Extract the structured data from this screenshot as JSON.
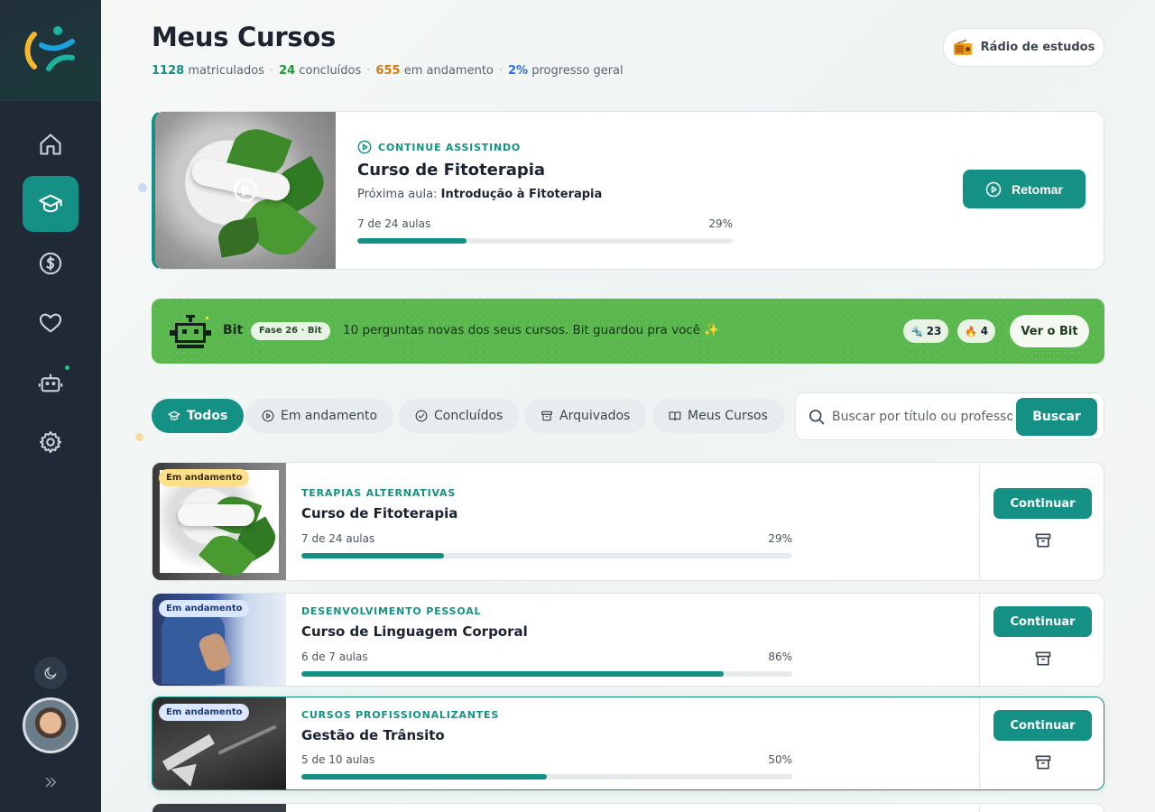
{
  "sidebar": {
    "items": [
      {
        "name": "home",
        "icon": "home-icon",
        "active": false
      },
      {
        "name": "courses",
        "icon": "graduation-cap-icon",
        "active": true
      },
      {
        "name": "finance",
        "icon": "dollar-circle-icon",
        "active": false
      },
      {
        "name": "favorites",
        "icon": "heart-icon",
        "active": false
      },
      {
        "name": "bot",
        "icon": "robot-icon",
        "active": false
      },
      {
        "name": "settings",
        "icon": "gear-icon",
        "active": false
      }
    ],
    "theme_icon": "moon-icon",
    "expand_icon": "chevrons-right-icon"
  },
  "header": {
    "title": "Meus Cursos",
    "stats": {
      "enrolled_value": "1128",
      "enrolled_label": "matriculados",
      "completed_value": "24",
      "completed_label": "concluídos",
      "in_progress_value": "655",
      "in_progress_label": "em andamento",
      "progress_value": "2%",
      "progress_label": "progresso geral"
    },
    "radio_label": "Rádio de estudos"
  },
  "continue": {
    "label": "CONTINUE ASSISTINDO",
    "title": "Curso de Fitoterapia",
    "next_prefix": "Próxima aula:",
    "next_lesson": "Introdução à Fitoterapia",
    "lessons_text": "7 de 24 aulas",
    "percent_text": "29%",
    "progress": 0.29,
    "resume_label": "Retomar"
  },
  "bit": {
    "name": "Bit",
    "phase": "Fase 26 · Bit",
    "message": "10 perguntas novas dos seus cursos. Bit guardou pra você ✨",
    "bolts_count": "23",
    "streak_count": "4",
    "cta_label": "Ver o Bit"
  },
  "filters": [
    {
      "label": "Todos",
      "active": true,
      "icon": "graduation-cap-icon"
    },
    {
      "label": "Em andamento",
      "active": false,
      "icon": "play-circle-icon"
    },
    {
      "label": "Concluídos",
      "active": false,
      "icon": "check-circle-icon"
    },
    {
      "label": "Arquivados",
      "active": false,
      "icon": "archive-icon"
    },
    {
      "label": "Meus Cursos",
      "active": false,
      "icon": "book-open-icon"
    }
  ],
  "search": {
    "placeholder": "Buscar por título ou professor",
    "button_label": "Buscar"
  },
  "courses": [
    {
      "badge": "Em andamento",
      "badge_style": "yellow",
      "category": "TERAPIAS ALTERNATIVAS",
      "title": "Curso de Fitoterapia",
      "lessons_text": "7 de 24 aulas",
      "percent_text": "29%",
      "progress": 0.29,
      "button_label": "Continuar"
    },
    {
      "badge": "Em andamento",
      "badge_style": "blue",
      "category": "DESENVOLVIMENTO PESSOAL",
      "title": "Curso de Linguagem Corporal",
      "lessons_text": "6 de 7 aulas",
      "percent_text": "86%",
      "progress": 0.86,
      "button_label": "Continuar"
    },
    {
      "badge": "Em andamento",
      "badge_style": "blue",
      "category": "CURSOS PROFISSIONALIZANTES",
      "title": "Gestão de Trânsito",
      "lessons_text": "5 de 10 aulas",
      "percent_text": "50%",
      "progress": 0.5,
      "button_label": "Continuar"
    }
  ],
  "colors": {
    "accent": "#149184",
    "sidebar": "#1f2a36",
    "bit_green": "#5bb84e",
    "enrolled": "#149184",
    "completed": "#1f9a3a",
    "in_progress": "#d07a12",
    "overall": "#2f6fe0"
  }
}
